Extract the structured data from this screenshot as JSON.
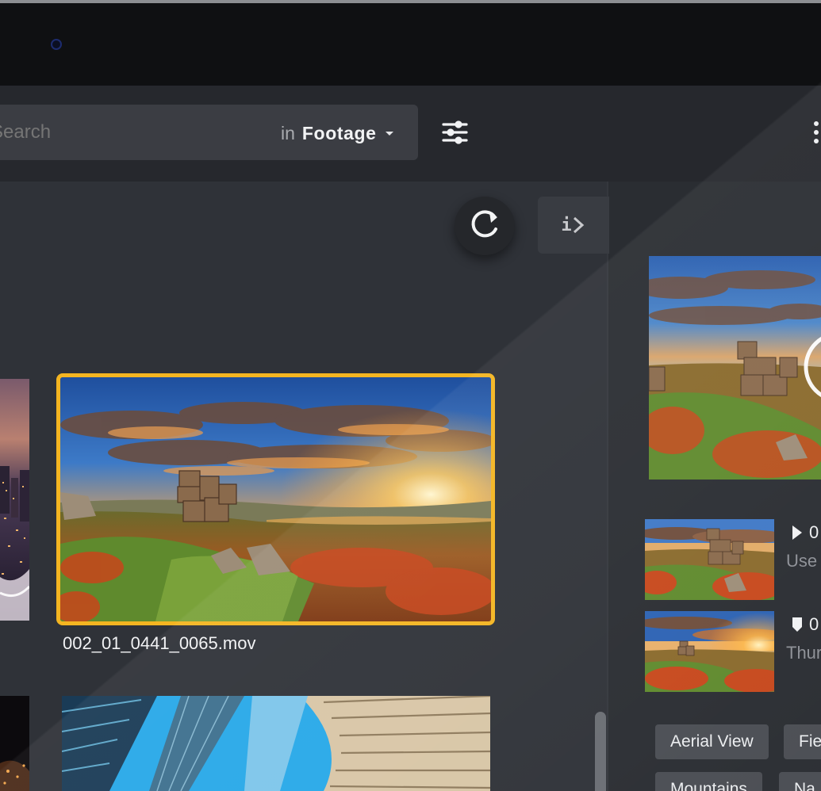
{
  "search": {
    "placeholder": "Search",
    "scope_prefix": "in",
    "scope_value": "Footage"
  },
  "toolbar": {
    "info_label": "i"
  },
  "grid": {
    "selected_clip_name": "002_01_0441_0065.mov"
  },
  "inspector": {
    "markers": [
      {
        "time": "0",
        "description": "Use",
        "icon": "play-triangle-icon"
      },
      {
        "time": "0",
        "description": "Thur",
        "icon": "marker-pin-icon"
      }
    ],
    "tags": [
      "Aerial View",
      "Fie",
      "Mountains",
      "Na"
    ]
  },
  "colors": {
    "selection_accent": "#f4b521",
    "background": "#2f3238",
    "toolbar": "#26282d"
  }
}
